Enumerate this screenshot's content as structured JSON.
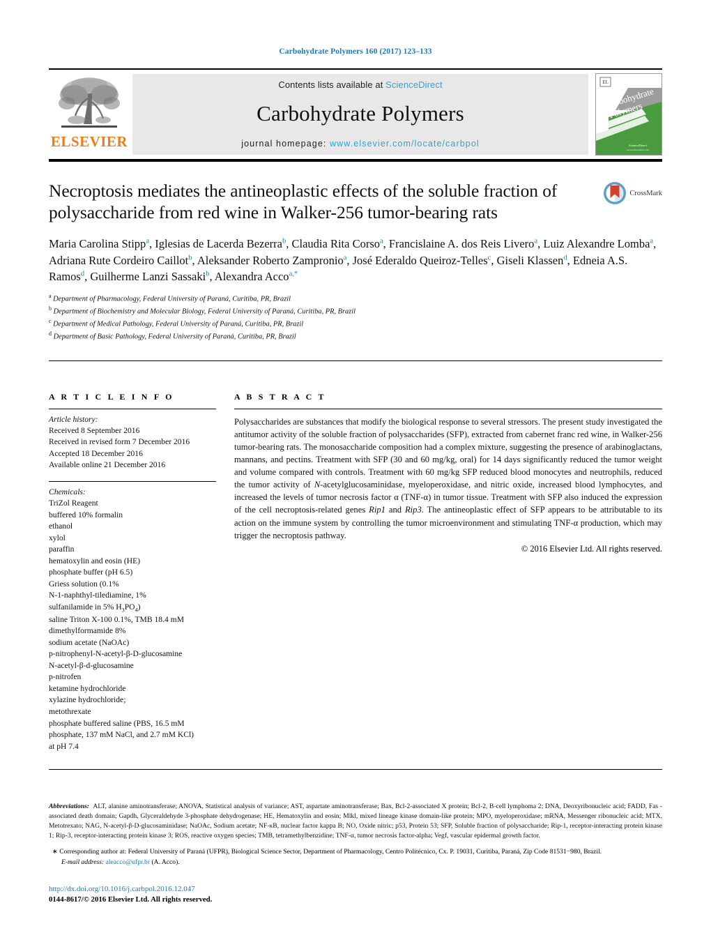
{
  "running_head": "Carbohydrate Polymers 160 (2017) 123–133",
  "masthead": {
    "publisher_logo_text": "ELSEVIER",
    "contents_prefix": "Contents lists available at ",
    "contents_link": "ScienceDirect",
    "journal_name": "Carbohydrate Polymers",
    "homepage_prefix": "journal homepage: ",
    "homepage_url": "www.elsevier.com/locate/carbpol",
    "cover_title_line1": "Carbohydrate",
    "cover_title_line2": "Polymers"
  },
  "article": {
    "title": "Necroptosis mediates the antineoplastic effects of the soluble fraction of polysaccharide from red wine in Walker-256 tumor-bearing rats",
    "crossmark_label": "CrossMark",
    "authors_html": "Maria Carolina Stipp<sup>a</sup>, Iglesias de Lacerda Bezerra<sup>b</sup>, Claudia Rita Corso<sup>a</sup>, Francislaine A. dos Reis Livero<sup>a</sup>, Luiz Alexandre Lomba<sup>a</sup>, Adriana Rute Cordeiro Caillot<sup>b</sup>, Aleksander Roberto Zampronio<sup>a</sup>, José Ederaldo Queiroz-Telles<sup>c</sup>, Giseli Klassen<sup>d</sup>, Edneia A.S. Ramos<sup>d</sup>, Guilherme Lanzi Sassaki<sup>b</sup>, Alexandra Acco<sup>a,*</sup>",
    "affiliations": [
      {
        "mark": "a",
        "text": "Department of Pharmacology, Federal University of Paraná, Curitiba, PR, Brazil"
      },
      {
        "mark": "b",
        "text": "Department of Biochemistry and Molecular Biology, Federal University of Paraná, Curitiba, PR, Brazil"
      },
      {
        "mark": "c",
        "text": "Department of Medical Pathology, Federal University of Paraná, Curitiba, PR, Brazil"
      },
      {
        "mark": "d",
        "text": "Department of Basic Pathology, Federal University of Paraná, Curitiba, PR, Brazil"
      }
    ]
  },
  "article_info": {
    "heading": "A R T I C L E   I N F O",
    "history_label": "Article history:",
    "history": [
      "Received 8 September 2016",
      "Received in revised form 7 December 2016",
      "Accepted 18 December 2016",
      "Available online 21 December 2016"
    ],
    "chemicals_label": "Chemicals:",
    "chemicals": [
      "TriZol Reagent",
      "buffered 10% formalin",
      "ethanol",
      "xylol",
      "paraffin",
      "hematoxylin and eosin (HE)",
      "phosphate buffer (pH 6.5)",
      "Griess solution (0.1%",
      "N-1-naphthyl-tilediamine, 1%",
      "sulfanilamide in 5% H3PO4)",
      "saline Triton X-100 0.1%, TMB 18.4 mM",
      "dimethylformamide 8%",
      "sodium acetate (NaOAc)",
      "p-nitrophenyl-N-acetyl-β-D-glucosamine",
      "N-acetyl-β-d-glucosamine",
      "p-nitrofen",
      "ketamine hydrochloride",
      "xylazine hydrochloride;",
      "metothrexate",
      "phosphate buffered saline (PBS, 16.5 mM",
      "phosphate, 137 mM NaCl, and 2.7 mM KCl)",
      "at pH 7.4"
    ]
  },
  "abstract": {
    "heading": "A B S T R A C T",
    "body_html": "Polysaccharides are substances that modify the biological response to several stressors. The present study investigated the antitumor activity of the soluble fraction of polysaccharides (SFP), extracted from cabernet franc red wine, in Walker-256 tumor-bearing rats. The monosaccharide composition had a complex mixture, suggesting the presence of arabinoglactans, mannans, and pectins. Treatment with SFP (30 and 60 mg/kg, oral) for 14 days significantly reduced the tumor weight and volume compared with controls. Treatment with 60 mg/kg SFP reduced blood monocytes and neutrophils, reduced the tumor activity of <i>N</i>-acetylglucosaminidase, myeloperoxidase, and nitric oxide, increased blood lymphocytes, and increased the levels of tumor necrosis factor α (TNF-α) in tumor tissue. Treatment with SFP also induced the expression of the cell necroptosis-related genes <i>Rip1</i> and <i>Rip3</i>. The antineoplastic effect of SFP appears to be attributable to its action on the immune system by controlling the tumor microenvironment and stimulating TNF-α production, which may trigger the necroptosis pathway.",
    "copyright": "© 2016 Elsevier Ltd. All rights reserved."
  },
  "footnotes": {
    "abbreviations_label": "Abbreviations:",
    "abbreviations_html": "ALT, alanine aminotransferase; ANOVA, Statistical analysis of variance; AST, aspartate aminotransferase; Bax, Bcl-2-associated X protein; Bcl-2, B-cell lymphoma 2; DNA, Deoxyribonucleic acid; FADD, Fas -associated death domain; Gapdh, Glyceraldehyde 3-phosphate dehydrogenase; HE, Hematoxylin and eosin; Mlkl, mixed lineage kinase domain-like protein; MPO, myeloperoxidase; mRNA, Messenger ribonucleic acid; MTX, Metotrexato; NAG, N-acetyl-β-D-glucosaminidase; NaOAc, Sodium acetate; NF-κB, nuclear factor kappa B; NO, Oxide nitric; p53, Protein 53; SFP, Soluble fraction of polysaccharide; Rip-1, receptor-interacting protein kinase 1; Rip-3, receptor-interacting protein kinase 3; ROS, reactive oxygen species; TMB, tetramethylbenzidine; TNF-α, tumor necrosis factor-alpha; Vegf, vascular epidermal growth factor.",
    "corresponding_marker": "∗",
    "corresponding_text": "Corresponding author at: Federal University of Paraná (UFPR), Biological Science Sector, Department of Pharmacology, Centro Politécnico, Cx. P. 19031, Curitiba, Paraná, Zip Code 81531−980, Brazil.",
    "email_label": "E-mail address:",
    "email_value": "aleacco@ufpr.br",
    "email_suffix": "(A. Acco).",
    "doi_url": "http://dx.doi.org/10.1016/j.carbpol.2016.12.047",
    "issn_line": "0144-8617/© 2016 Elsevier Ltd. All rights reserved."
  },
  "colors": {
    "link_blue": "#1a7bb9",
    "sciencedirect_blue": "#2fa3d4",
    "elsevier_orange": "#f07c1a",
    "masthead_gray": "#e8e8e8",
    "cover_green": "#4a9b3f"
  }
}
